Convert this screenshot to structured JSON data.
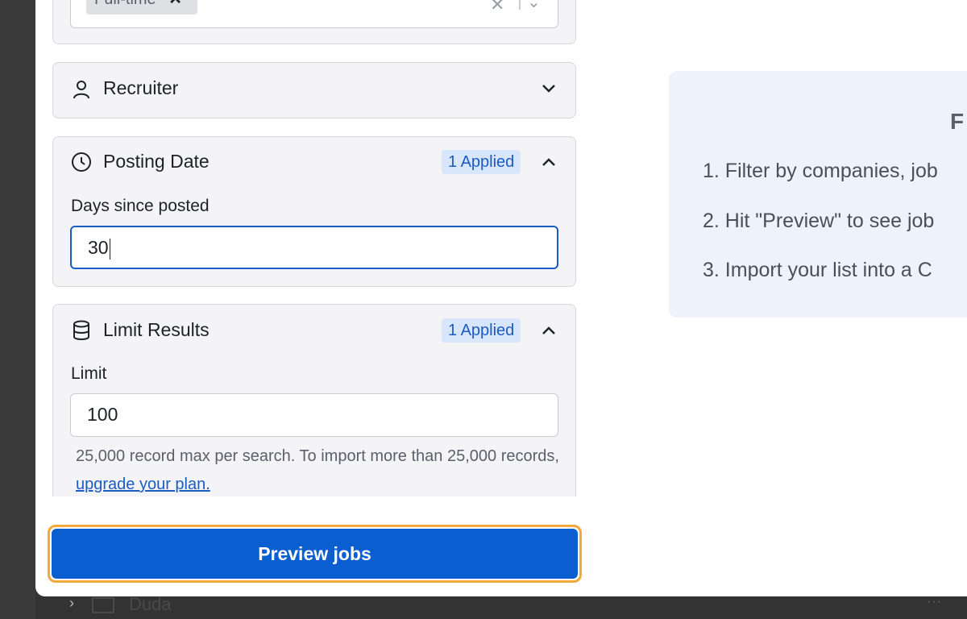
{
  "filters": {
    "employment_chip": "Full-time",
    "recruiter": {
      "title": "Recruiter"
    },
    "posting_date": {
      "title": "Posting Date",
      "badge": "1 Applied",
      "field_label": "Days since posted",
      "value": "30"
    },
    "limit_results": {
      "title": "Limit Results",
      "badge": "1 Applied",
      "field_label": "Limit",
      "value": "100",
      "help_text": "25,000 record max per search. To import more than 25,000 records,",
      "help_link": "upgrade your plan."
    }
  },
  "actions": {
    "preview_label": "Preview jobs"
  },
  "info": {
    "heading": "F",
    "steps": [
      "1. Filter by companies, job",
      "2. Hit \"Preview\" to see job",
      "3. Import your list into a C"
    ]
  },
  "background": {
    "row_label": "Duda",
    "more": "···"
  },
  "colors": {
    "accent": "#0b5ed0",
    "badge_bg": "#d7e6fa",
    "focus_ring": "#f2a93b"
  }
}
